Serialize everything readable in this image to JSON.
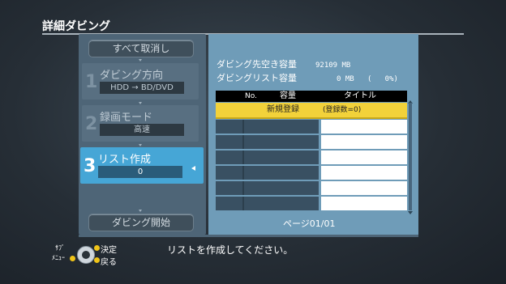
{
  "screen_title": "詳細ダビング",
  "left_menu": {
    "cancel_all": "すべて取消し",
    "steps": [
      {
        "number": "1",
        "label": "ダビング方向",
        "value": "HDD → BD/DVD",
        "active": false
      },
      {
        "number": "2",
        "label": "録画モード",
        "value": "高速",
        "active": false
      },
      {
        "number": "3",
        "label": "リスト作成",
        "value": "0",
        "active": true
      }
    ],
    "start_button": "ダビング開始"
  },
  "info": {
    "free_space_label": "ダビング先空き容量",
    "free_space_value": "92109 MB",
    "list_size_label": "ダビングリスト容量",
    "list_size_value": "0 MB",
    "list_size_percent": "(   0%)"
  },
  "table": {
    "headers": [
      "No.",
      "容量",
      "タイトル"
    ],
    "new_entry_label": "新規登録",
    "new_entry_count": "(登録数=0)",
    "page": "ページ01/01"
  },
  "footer": {
    "help_text": "リストを作成してください。",
    "sub_menu": "ｻﾌﾞ",
    "menu": "ﾒﾆｭｰ",
    "decide": "決定",
    "back": "戻る"
  },
  "colors": {
    "active_step": "#46a6d6",
    "highlight_row": "#f2d23a",
    "panel": "#6f9cb8"
  }
}
